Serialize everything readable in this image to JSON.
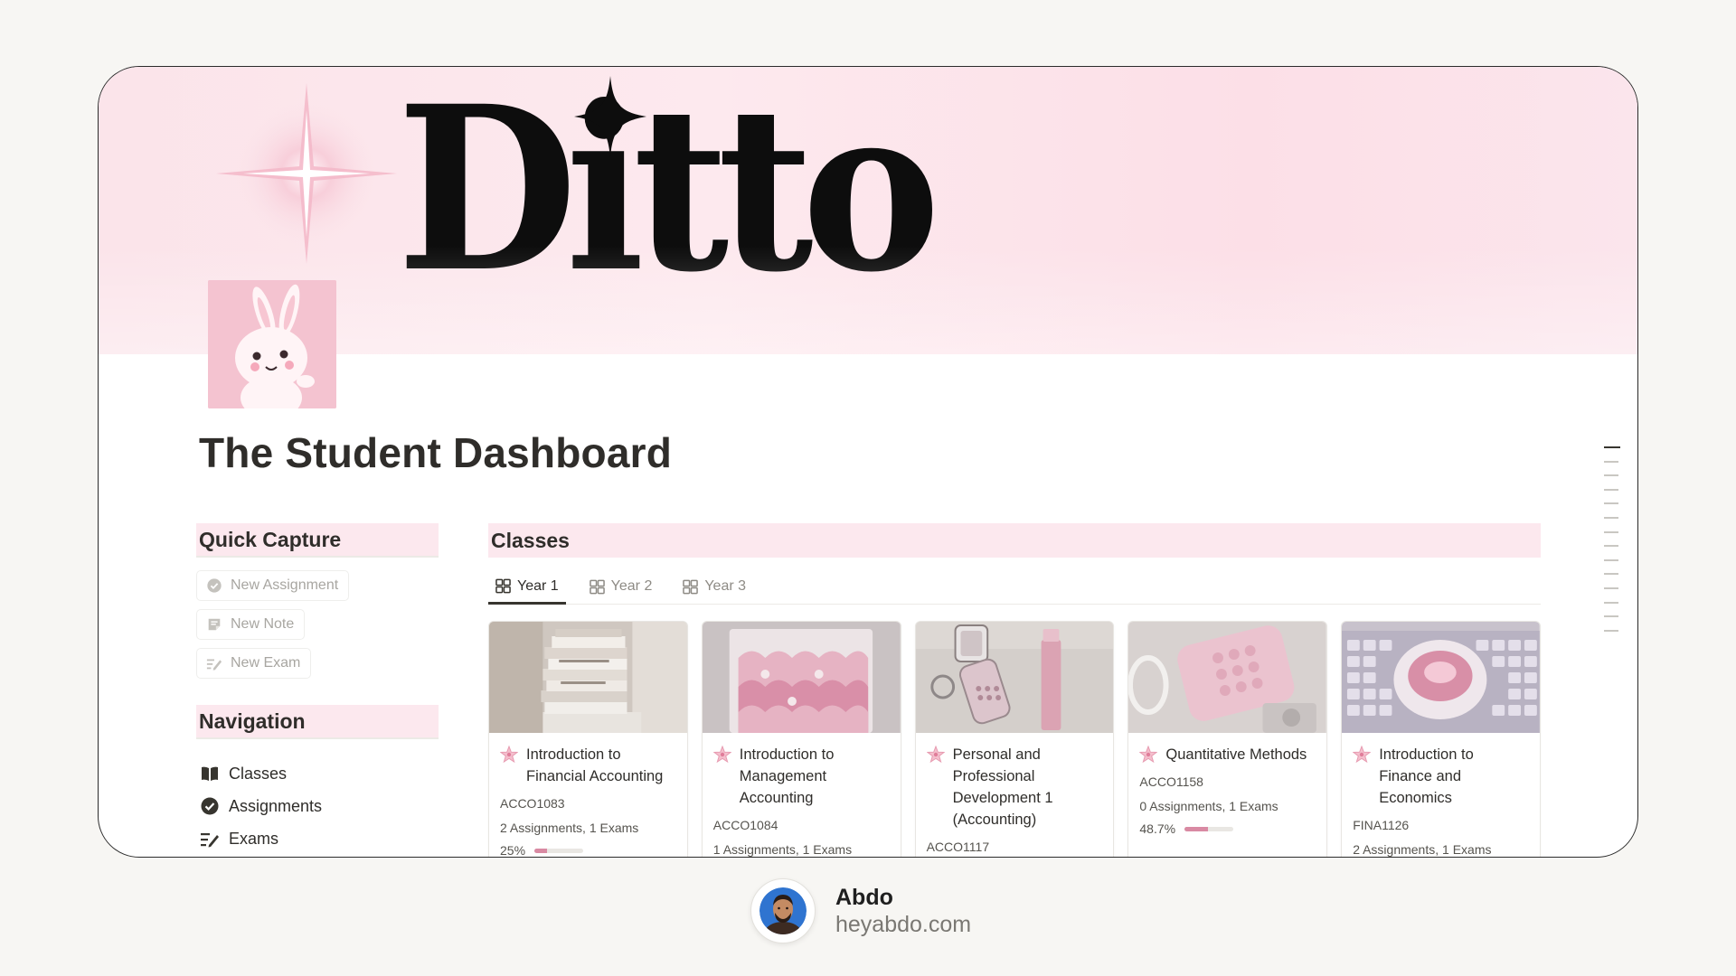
{
  "banner": {
    "logo_text": "Ditto"
  },
  "page": {
    "title": "The Student Dashboard"
  },
  "quick_capture": {
    "heading": "Quick Capture",
    "buttons": [
      {
        "label": "New Assignment",
        "icon": "check-circle-icon"
      },
      {
        "label": "New Note",
        "icon": "note-icon"
      },
      {
        "label": "New Exam",
        "icon": "edit-list-icon"
      }
    ]
  },
  "navigation": {
    "heading": "Navigation",
    "items": [
      {
        "label": "Classes",
        "icon": "book-icon"
      },
      {
        "label": "Assignments",
        "icon": "check-circle-icon"
      },
      {
        "label": "Exams",
        "icon": "edit-list-icon"
      }
    ]
  },
  "classes": {
    "heading": "Classes",
    "tabs": [
      {
        "label": "Year 1",
        "active": true
      },
      {
        "label": "Year 2",
        "active": false
      },
      {
        "label": "Year 3",
        "active": false
      }
    ],
    "cards": [
      {
        "title": "Introduction to Financial Accounting",
        "code": "ACCO1083",
        "stats": "2 Assignments, 1 Exams",
        "progress_label": "25%",
        "progress": 0.25
      },
      {
        "title": "Introduction to Management Accounting",
        "code": "ACCO1084",
        "stats": "1 Assignments, 1 Exams",
        "progress_label": "",
        "progress": null
      },
      {
        "title": "Personal and Professional Development 1 (Accounting)",
        "code": "ACCO1117",
        "stats": "",
        "progress_label": "",
        "progress": null
      },
      {
        "title": "Quantitative Methods",
        "code": "ACCO1158",
        "stats": "0 Assignments, 1 Exams",
        "progress_label": "48.7%",
        "progress": 0.487
      },
      {
        "title": "Introduction to Finance and Economics",
        "code": "FINA1126",
        "stats": "2 Assignments, 1 Exams",
        "progress_label": "",
        "progress": null
      }
    ]
  },
  "footer": {
    "name": "Abdo",
    "site": "heyabdo.com"
  },
  "colors": {
    "accent_pink": "#fce8ee",
    "progress_pink": "#d98aa3",
    "text": "#37352f"
  }
}
